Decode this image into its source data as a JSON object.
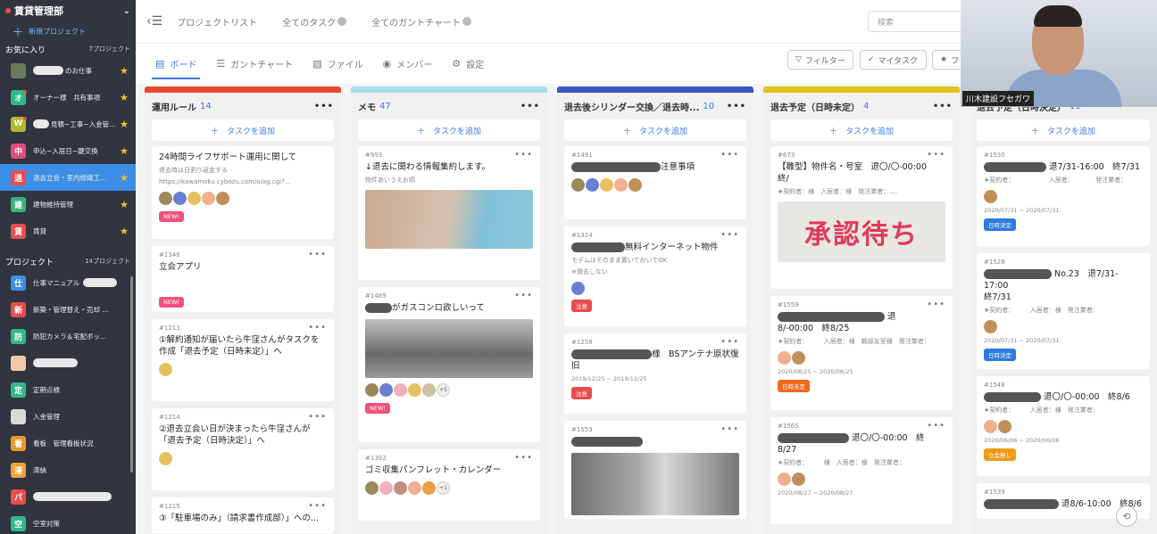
{
  "sidebar": {
    "org": "賃貸管理部",
    "new_project": "新規プロジェクト",
    "favorites_label": "お気に入り",
    "favorites_count": "7プロジェクト",
    "favorites": [
      {
        "av": "",
        "label": "のお仕事",
        "color": "#6b7a5a"
      },
      {
        "av": "オ",
        "label": "オーナー様　共有事項",
        "color": "#2fb98a"
      },
      {
        "av": "W",
        "label": "見積~工事~入金管...",
        "color": "#b3b830"
      },
      {
        "av": "中",
        "label": "申込~入居日~鍵交換",
        "color": "#e24b7a"
      },
      {
        "av": "退",
        "label": "退去立会・室内修繕工...",
        "color": "#e94e4e"
      },
      {
        "av": "建",
        "label": "建物維持管理",
        "color": "#36b37e"
      },
      {
        "av": "賃",
        "label": "賃貸",
        "color": "#e94e4e"
      }
    ],
    "projects_label": "プロジェクト",
    "projects_count": "14プロジェクト",
    "projects": [
      {
        "av": "仕",
        "label": "仕事マニュアル",
        "color": "#3d8ee6"
      },
      {
        "av": "新",
        "label": "新築・管理替え・売却 ...",
        "color": "#e94e4e"
      },
      {
        "av": "防",
        "label": "防犯カメラ＆宅配ボッ...",
        "color": "#2fb98a"
      },
      {
        "av": "",
        "label": "",
        "color": "#f3c9a6"
      },
      {
        "av": "定",
        "label": "定期点検",
        "color": "#2fb98a"
      },
      {
        "av": "",
        "label": "入金管理",
        "color": "#d8d8d8"
      },
      {
        "av": "看",
        "label": "看板　管理看板状況",
        "color": "#e89a2a"
      },
      {
        "av": "滞",
        "label": "滞納",
        "color": "#f2a23a"
      },
      {
        "av": "パ",
        "label": "",
        "color": "#e94e4e"
      },
      {
        "av": "空",
        "label": "空室対策",
        "color": "#2fb98a"
      }
    ]
  },
  "topbar": {
    "project_list": "プロジェクトリスト",
    "all_tasks": "全てのタスク",
    "all_gantt": "全てのガントチャート",
    "search_placeholder": "検索"
  },
  "viewbar": {
    "board": "ボード",
    "gantt": "ガントチャート",
    "file": "ファイル",
    "member": "メンバー",
    "settings": "設定",
    "filter": "フィルター",
    "mytask": "マイタスク",
    "third": "フ"
  },
  "add_task": "タスクを追加",
  "columns": [
    {
      "title": "運用ルール",
      "count": "14",
      "color": "#e9492d"
    },
    {
      "title": "メモ",
      "count": "47",
      "color": "#a8dcf0"
    },
    {
      "title": "退去後シリンダー交換／退去時...",
      "count": "10",
      "color": "#3b55c4"
    },
    {
      "title": "退去予定（日時未定）",
      "count": "4",
      "color": "#e6c21f"
    },
    {
      "title": "退去予定（日時決定）",
      "count": "11",
      "color": "#2fb98a"
    }
  ],
  "cards": {
    "c1a": {
      "title": "24時間ライフサポート運用に関して",
      "sub1": "退去時は日割り返金する",
      "sub2": "https://kawamoku.cybozu.com/o/ag.cgi?...",
      "badge": "NEW!"
    },
    "c1b": {
      "id": "#1346",
      "title": "立会アプリ",
      "badge": "NEW!"
    },
    "c1c": {
      "id": "#1213",
      "title": "①解約通知が届いたら牛窪さんがタスクを作成「退去予定（日時未定）」へ"
    },
    "c1d": {
      "id": "#1214",
      "title": "②退去立会い日が決まったら牛窪さんが「退去予定（日時決定）」へ"
    },
    "c1e": {
      "id": "#1215",
      "title": "③「駐車場のみ」（請求書作成部）」への..."
    },
    "c2a": {
      "id": "#993",
      "title": "↓退去に関わる情報集約します。",
      "sub": "物件あいうえお順"
    },
    "c2b": {
      "id": "#1489",
      "title": "がガスコンロ欲しいって",
      "badge": "NEW!",
      "more": "+5"
    },
    "c2c": {
      "id": "#1392",
      "title": "ゴミ収集パンフレット・カレンダー",
      "more": "+1"
    },
    "c3a": {
      "id": "#1491",
      "title": "注意事項"
    },
    "c3b": {
      "id": "#1324",
      "title": "無料インターネット物件",
      "sub1": "モデムはそのまま置いておいてOK",
      "sub2": "※貸去しない",
      "badge": "注意"
    },
    "c3c": {
      "id": "#1258",
      "title": "様　BSアンテナ原状復旧",
      "date": "2019/12/25 ~ 2019/12/25",
      "badge": "注意"
    },
    "c3d": {
      "id": "#1553"
    },
    "c4a": {
      "id": "#673",
      "title": "【雛型】物件名・号室　退〇/〇-00:00　終/",
      "sub": "★契約者：様　入居者：様　発注業者：....",
      "stamp": "承認待ち"
    },
    "c4b": {
      "id": "#1559",
      "title1": "退",
      "title2": "8/-00:00　終8/25",
      "sub": "★契約者：　　　入居者：様　鵜部友室様　発注業者：",
      "date": "2020/08/25 ~ 2020/08/25",
      "badge": "日時未定"
    },
    "c4c": {
      "id": "#1565",
      "title1": "退〇/〇-00:00　終",
      "title2": "8/27",
      "sub": "★契約者：　　　様　入居者：様　発注業者：",
      "date": "2020/08/27 ~ 2020/08/27"
    },
    "c5a": {
      "id": "#1530",
      "title": "退7/31-16:00　終7/31",
      "sub": "★契約者：　　　　　　入居者：　　　　発注業者：",
      "date": "2020/07/31 ~ 2020/07/31",
      "badge": "日時決定"
    },
    "c5b": {
      "id": "#1528",
      "title1": "No.23　退7/31-17:00",
      "title2": "終7/31",
      "sub": "★契約者：　　　入居者：様　発注業者：",
      "date": "2020/07/31 ~ 2020/07/31",
      "badge": "日時決定"
    },
    "c5c": {
      "id": "#1548",
      "title": "退〇/〇-00:00　終8/6",
      "sub": "★契約者：　　　入居者：様　発注業者：",
      "date": "2020/06/06 ~ 2020/06/06",
      "badge": "立会無し"
    },
    "c5d": {
      "id": "#1539",
      "title": "退8/6-10:00　終8/6"
    }
  },
  "video": {
    "name": "川木建設フセガワ"
  },
  "colors": {
    "accent": "#3d7be0",
    "sidebar": "#303540",
    "new_badge": "#f0527a",
    "caution_badge": "#e84d4d",
    "undecided_badge": "#f06a1a",
    "decided_badge": "#2b7be0",
    "noattend_badge": "#f09a1a"
  }
}
